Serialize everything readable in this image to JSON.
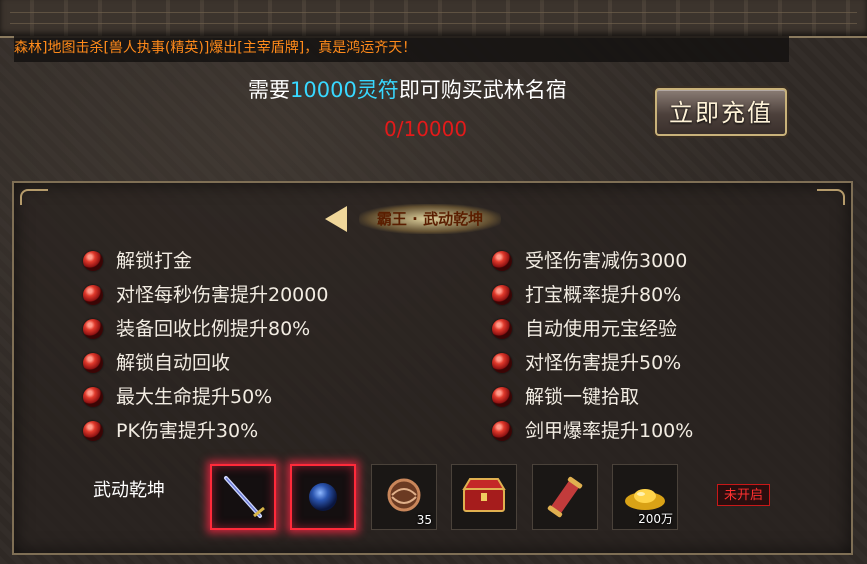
{
  "marquee": "森林]地图击杀[兽人执事(精英)]爆出[主宰盾牌]，真是鸿运齐天！",
  "requirement": {
    "prefix": "需要",
    "amount": "10000灵符",
    "suffix": "即可购买武林名宿"
  },
  "progress": "0/10000",
  "recharge_label": "立即充值",
  "title": "霸王 · 武动乾坤",
  "features_left": [
    "解锁打金",
    "对怪每秒伤害提升20000",
    "装备回收比例提升80%",
    "解锁自动回收",
    "最大生命提升50%",
    "PK伤害提升30%"
  ],
  "features_right": [
    "受怪伤害减伤3000",
    "打宝概率提升80%",
    "自动使用元宝经验",
    "对怪伤害提升50%",
    "解锁一键拾取",
    "剑甲爆率提升100%"
  ],
  "rewards_label": "武动乾坤",
  "rewards": [
    {
      "icon": "sword-icon",
      "qty": "",
      "selected": true
    },
    {
      "icon": "blue-orb-icon",
      "qty": "",
      "selected": true
    },
    {
      "icon": "pouch-icon",
      "qty": "35",
      "selected": false
    },
    {
      "icon": "treasure-chest-icon",
      "qty": "",
      "selected": false
    },
    {
      "icon": "scroll-icon",
      "qty": "",
      "selected": false
    },
    {
      "icon": "gold-ingot-icon",
      "qty": "200万",
      "selected": false
    }
  ],
  "status_badge": "未开启",
  "colors": {
    "highlight": "#38d8ff",
    "progress": "#e31a1a",
    "marquee": "#ff8a1a",
    "selected_border": "#ff2a3a"
  }
}
